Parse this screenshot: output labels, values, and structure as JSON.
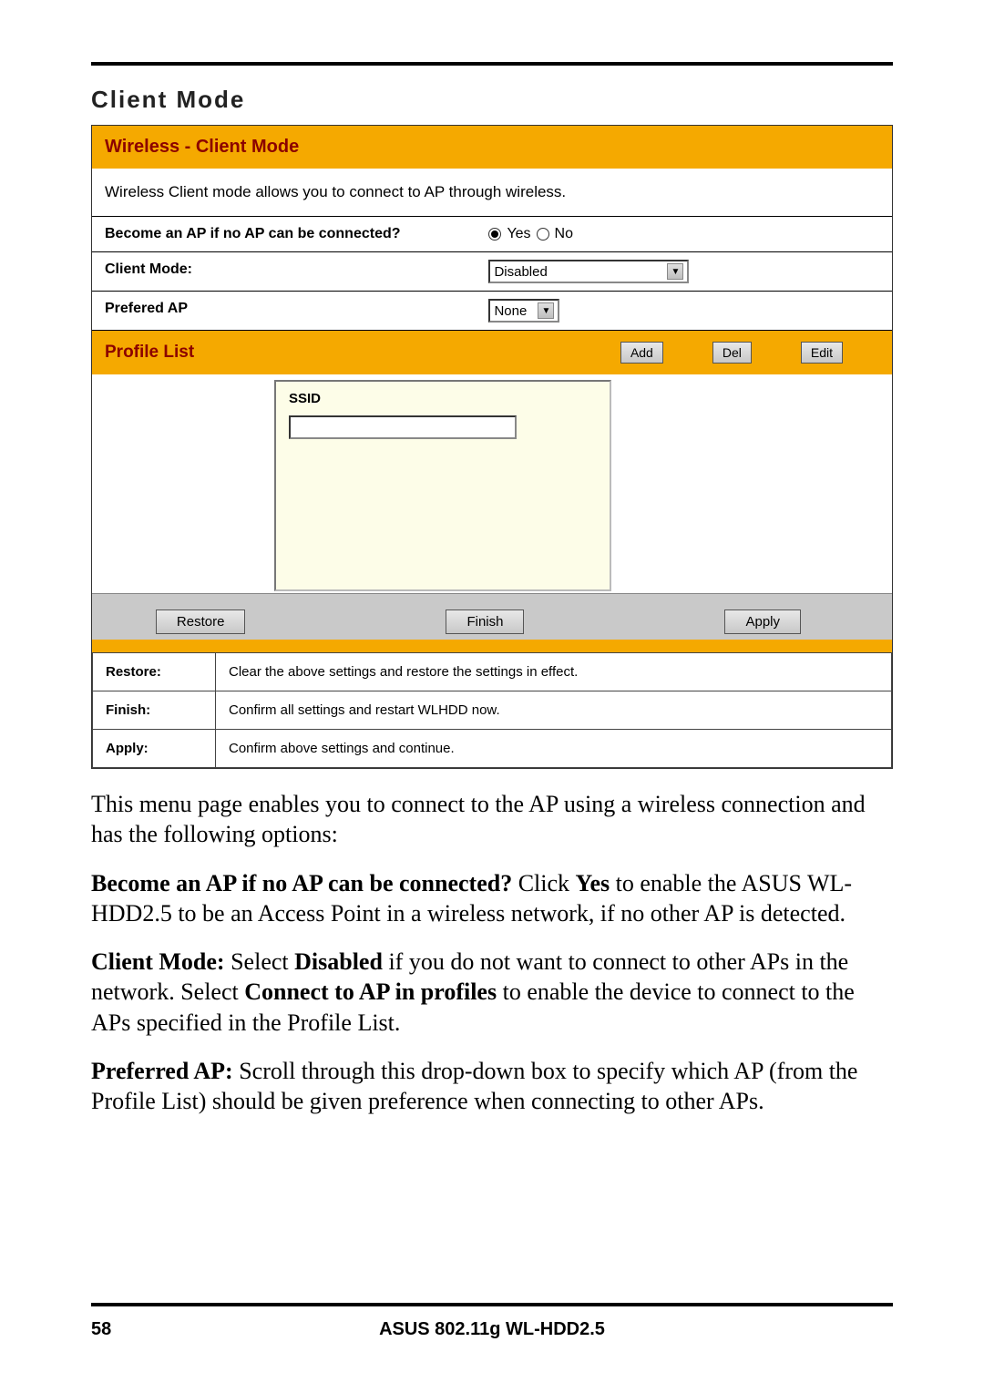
{
  "section_title": "Client Mode",
  "panel": {
    "header": "Wireless - Client Mode",
    "description": "Wireless Client mode allows you to connect to AP through wireless.",
    "become_ap": {
      "label": "Become an AP if no AP can be connected?",
      "yes": "Yes",
      "no": "No"
    },
    "client_mode": {
      "label": "Client Mode:",
      "value": "Disabled"
    },
    "prefered_ap": {
      "label": "Prefered AP",
      "value": "None"
    },
    "profile_list": {
      "label": "Profile List",
      "add": "Add",
      "del": "Del",
      "edit": "Edit"
    },
    "ssid_label": "SSID",
    "bottom_buttons": {
      "restore": "Restore",
      "finish": "Finish",
      "apply": "Apply"
    },
    "descriptions": {
      "restore_key": "Restore:",
      "restore_val": "Clear the above settings and restore the settings in effect.",
      "finish_key": "Finish:",
      "finish_val": "Confirm all settings and restart WLHDD now.",
      "apply_key": "Apply:",
      "apply_val": "Confirm above settings and continue."
    }
  },
  "body": {
    "p1": "This menu page enables you to connect to the AP using a wireless connection and has the following options:",
    "p2a": "Become an AP if no AP can be connected?",
    "p2b": " Click ",
    "p2c": "Yes",
    "p2d": " to enable the ASUS WL-HDD2.5 to be an Access Point in a wireless network, if no other AP is detected.",
    "p3a": "Client Mode:",
    "p3b": " Select ",
    "p3c": "Disabled",
    "p3d": " if you do not want to connect to other APs in the network. Select ",
    "p3e": "Connect to AP in profiles",
    "p3f": " to enable the device to connect to the APs specified in the Profile List.",
    "p4a": "Preferred AP:",
    "p4b": " Scroll through this drop-down box to specify which AP (from the Profile List) should be given preference when connect­ing to other APs."
  },
  "footer": {
    "page": "58",
    "title": "ASUS 802.11g WL-HDD2.5"
  }
}
